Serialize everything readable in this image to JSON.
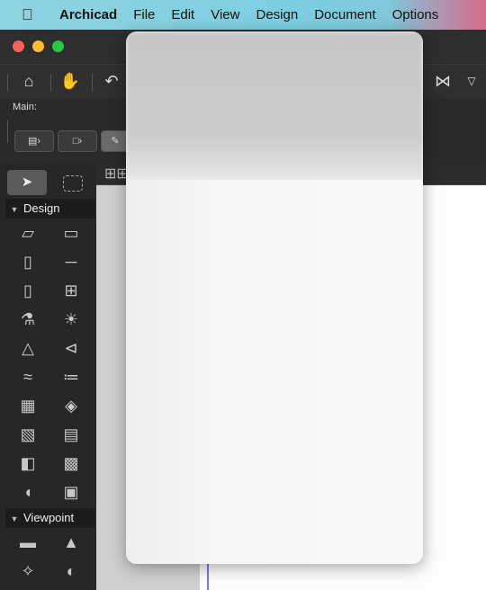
{
  "menubar": {
    "app_name": "Archicad",
    "items": [
      "File",
      "Edit",
      "View",
      "Design",
      "Document",
      "Options"
    ]
  },
  "infobox": {
    "main_label": "Main:"
  },
  "toolbox": {
    "sections": [
      {
        "label": "Design"
      },
      {
        "label": "Viewpoint"
      }
    ],
    "design_tools": [
      "wall-icon",
      "slab-icon",
      "column-icon",
      "beam-icon",
      "door-icon",
      "window-icon",
      "object-icon",
      "lamp-icon",
      "roof-icon",
      "shell-icon",
      "stair-icon",
      "railing-icon",
      "curtain-wall-icon",
      "morph-icon",
      "mesh-grid-icon",
      "zone-icon",
      "skylight-icon",
      "surface-icon",
      "opening-icon",
      "zone-stamp-icon"
    ],
    "viewpoint_tools": [
      "section-icon",
      "elevation-icon",
      "camera-icon",
      "interior-elevation-icon"
    ]
  },
  "colors": {
    "accent_line": "#6b7cff",
    "traffic_red": "#fe5f57",
    "traffic_yellow": "#febc2e",
    "traffic_green": "#28c840"
  }
}
